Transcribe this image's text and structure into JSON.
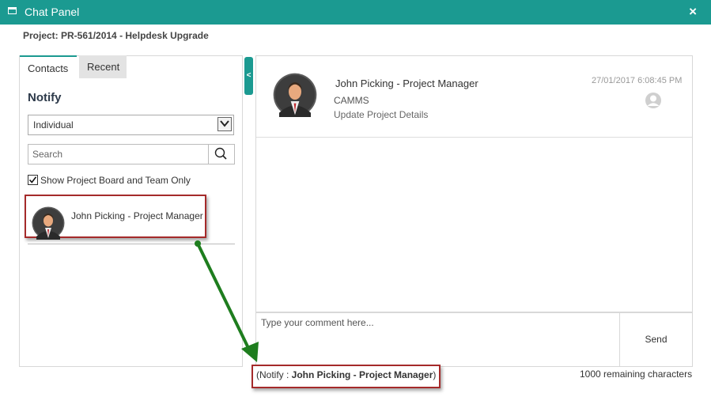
{
  "window": {
    "title": "Chat Panel",
    "close_glyph": "×"
  },
  "project": {
    "label": "Project: PR-561/2014 - Helpdesk Upgrade"
  },
  "tabs": [
    {
      "label": "Contacts"
    },
    {
      "label": "Recent"
    }
  ],
  "notify": {
    "heading": "Notify",
    "select_value": "Individual",
    "search_placeholder": "Search",
    "show_board_label": "Show Project Board and Team Only",
    "show_board_checked": true
  },
  "contacts": [
    {
      "name": "John Picking - Project Manager"
    }
  ],
  "collapse_glyph": "<",
  "messages": [
    {
      "author": "John Picking - Project Manager",
      "org": "CAMMS",
      "text": "Update Project Details",
      "timestamp": "27/01/2017 6:08:45 PM"
    }
  ],
  "comment": {
    "placeholder": "Type your comment here...",
    "send_label": "Send"
  },
  "notify_summary": {
    "prefix": "(Notify : ",
    "name": "John Picking - Project Manager",
    "suffix": ")"
  },
  "remaining": "1000 remaining characters",
  "colors": {
    "accent": "#1b9a91",
    "highlight_border": "#a52a2a",
    "arrow": "#1e7d1e"
  },
  "icons": [
    "window-icon",
    "close-icon",
    "chevron-down-icon",
    "search-icon",
    "checkbox-icon",
    "avatar-icon",
    "user-placeholder-icon",
    "arrow-icon"
  ]
}
